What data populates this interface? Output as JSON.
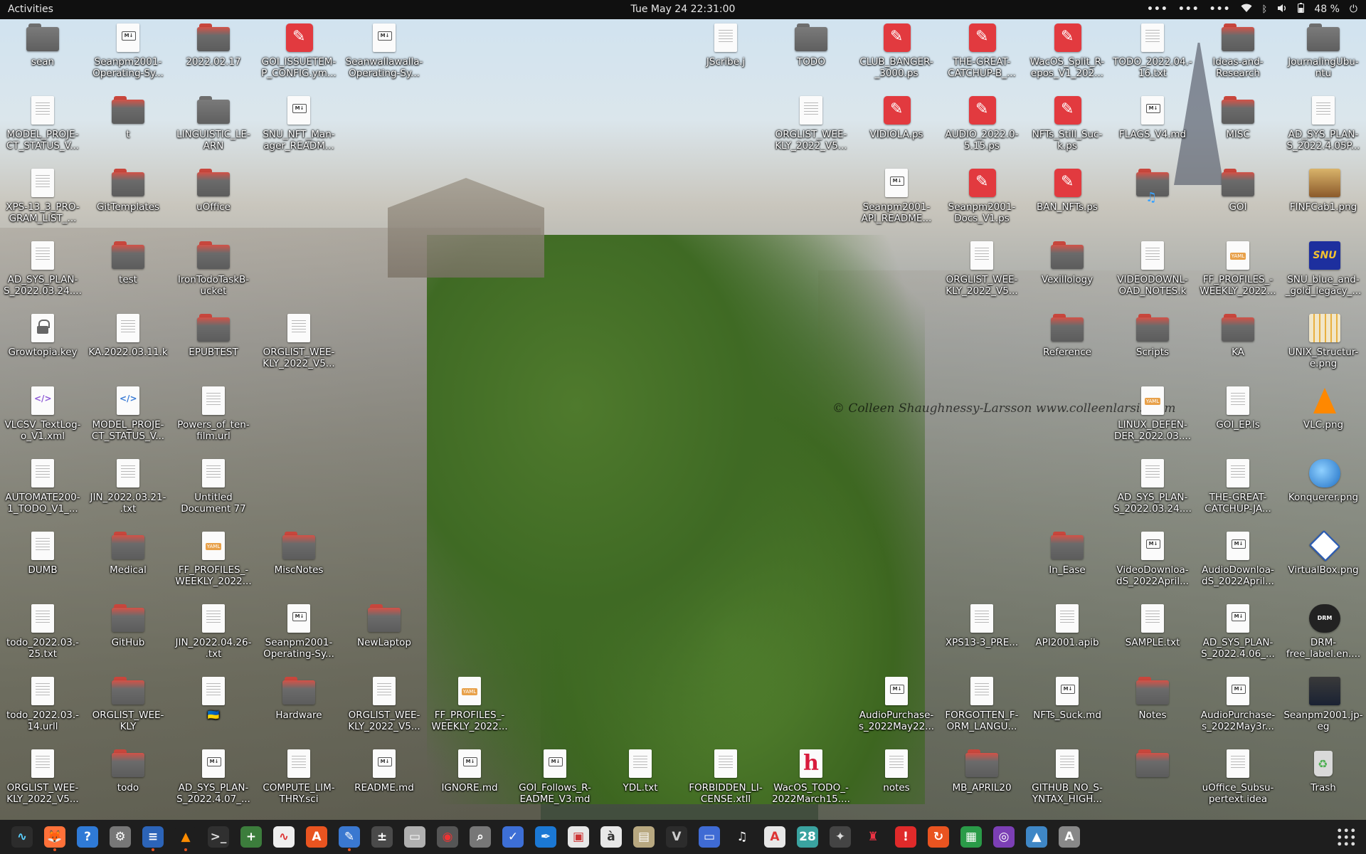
{
  "topbar": {
    "activities": "Activities",
    "clock": "Tue May 24  22:31:00",
    "overflow1": "•••",
    "overflow2": "•••",
    "overflow3": "•••",
    "battery": "48 %"
  },
  "wallpaper": {
    "watermark": "© Colleen Shaughnessy-Larsson www.colleenlarsis.com"
  },
  "desktop": {
    "icons": [
      {
        "label": "sean",
        "kind": "folder",
        "icon": "home-folder-icon"
      },
      {
        "label": "Seanpm2001-\nOperating-Sy...",
        "kind": "doc-md"
      },
      {
        "label": "2022.02.17",
        "kind": "folder-red"
      },
      {
        "label": "GOI_ISSUETEM-\nP_CONFIG.ym...",
        "kind": "ps"
      },
      {
        "label": "Seanwallawalla-\nOperating-Sy...",
        "kind": "doc-md"
      },
      {
        "label": "JScribe.j",
        "kind": "doc"
      },
      {
        "label": "TODO",
        "kind": "folder"
      },
      {
        "label": "CLUB_BANGER-\n_3000.ps",
        "kind": "ps"
      },
      {
        "label": "THE-GREAT-\nCATCHUP-B_...",
        "kind": "ps"
      },
      {
        "label": "WacOS_Split_R-\nepos_V1_202...",
        "kind": "ps"
      },
      {
        "label": "TODO_2022.04.-\n16.txt",
        "kind": "doc"
      },
      {
        "label": "Ideas-and-\nResearch",
        "kind": "folder-red"
      },
      {
        "label": "JournalingUbu-\nntu",
        "kind": "folder"
      },
      {
        "label": "MODEL_PROJE-\nCT_STATUS_V...",
        "kind": "doc"
      },
      {
        "label": "t",
        "kind": "folder-red"
      },
      {
        "label": "LINGUISTIC_LE-\nARN",
        "kind": "folder"
      },
      {
        "label": "SNU_NFT_Man-\nager_READM...",
        "kind": "doc-md"
      },
      {
        "label": "ORGLIST_WEE-\nKLY_2022_V5...",
        "kind": "doc"
      },
      {
        "label": "VIDIOLA.ps",
        "kind": "ps"
      },
      {
        "label": "AUDIO_2022.0-\n5.15.ps",
        "kind": "ps"
      },
      {
        "label": "NFTs_Still_Suc-\nk.ps",
        "kind": "ps"
      },
      {
        "label": "FLAGS_V4.md",
        "kind": "doc-md"
      },
      {
        "label": "MISC",
        "kind": "folder-red"
      },
      {
        "label": "AD_SYS_PLAN-\nS_2022.4.05P...",
        "kind": "doc"
      },
      {
        "label": "XPS-13_3_PRO-\nGRAM_LIST_...",
        "kind": "doc"
      },
      {
        "label": "GitTemplates",
        "kind": "folder-red"
      },
      {
        "label": "uOffice",
        "kind": "folder-red"
      },
      {
        "label": "Seanpm2001-\nAPI_README...",
        "kind": "doc-md"
      },
      {
        "label": "Seanpm2001-\nDocs_V1.ps",
        "kind": "ps"
      },
      {
        "label": "BAN_NFTs.ps",
        "kind": "ps"
      },
      {
        "label": "",
        "kind": "folder-music"
      },
      {
        "label": "GOI",
        "kind": "folder-red"
      },
      {
        "label": "FINFCab1.png",
        "kind": "img-cabinet"
      },
      {
        "label": "AD_SYS_PLAN-\nS_2022.03.24....",
        "kind": "doc"
      },
      {
        "label": "test",
        "kind": "folder-red"
      },
      {
        "label": "IronTodoTaskB-\nucket",
        "kind": "folder-red"
      },
      {
        "label": "ORGLIST_WEE-\nKLY_2022_V5...",
        "kind": "doc"
      },
      {
        "label": "Vexillology",
        "kind": "folder-red"
      },
      {
        "label": "VIDEODOWNL-\nOAD_NOTES.k",
        "kind": "doc"
      },
      {
        "label": "FF_PROFILES_-\nWEEKLY_2022...",
        "kind": "doc-yaml"
      },
      {
        "label": "SNU_blue_and-\n_gold_legacy_...",
        "kind": "img-snu"
      },
      {
        "label": "Growtopia.key",
        "kind": "doc-lock"
      },
      {
        "label": "KA.2022.03.11.k",
        "kind": "doc"
      },
      {
        "label": "EPUBTEST",
        "kind": "folder-red"
      },
      {
        "label": "ORGLIST_WEE-\nKLY_2022_V5...",
        "kind": "doc"
      },
      {
        "label": "Reference",
        "kind": "folder-red"
      },
      {
        "label": "Scripts",
        "kind": "folder-red"
      },
      {
        "label": "KA",
        "kind": "folder-red"
      },
      {
        "label": "UNIX_Structur-\ne.png",
        "kind": "img-unix"
      },
      {
        "label": "VLCSV_TextLog-\no_V1.xml",
        "kind": "doc-xml"
      },
      {
        "label": "MODEL_PROJE-\nCT_STATUS_V...",
        "kind": "doc-code"
      },
      {
        "label": "Powers_of_ten-\nfilm.url",
        "kind": "doc"
      },
      {
        "label": "LINUX_DEFEN-\nDER_2022.03....",
        "kind": "doc-yaml"
      },
      {
        "label": "GOI_EP.ls",
        "kind": "doc"
      },
      {
        "label": "VLC.png",
        "kind": "img-vlc"
      },
      {
        "label": "AUTOMATE200-\n1_TODO_V1_...",
        "kind": "doc"
      },
      {
        "label": "JIN_2022.03.21-\n.txt",
        "kind": "doc"
      },
      {
        "label": "Untitled\nDocument 77",
        "kind": "doc"
      },
      {
        "label": "AD_SYS_PLAN-\nS_2022.03.24....",
        "kind": "doc"
      },
      {
        "label": "THE-GREAT-\nCATCHUP-JA...",
        "kind": "doc"
      },
      {
        "label": "Konquerer.png",
        "kind": "img-konq"
      },
      {
        "label": "DUMB",
        "kind": "doc"
      },
      {
        "label": "Medical",
        "kind": "folder-red"
      },
      {
        "label": "FF_PROFILES_-\nWEEKLY_2022...",
        "kind": "doc-yaml"
      },
      {
        "label": "MiscNotes",
        "kind": "folder-red"
      },
      {
        "label": "In_Ease",
        "kind": "folder-red"
      },
      {
        "label": "VideoDownloa-\ndS_2022April...",
        "kind": "doc-md"
      },
      {
        "label": "AudioDownloa-\ndS_2022April...",
        "kind": "doc-md"
      },
      {
        "label": "VirtualBox.png",
        "kind": "img-vbox"
      },
      {
        "label": "todo_2022.03.-\n25.txt",
        "kind": "doc"
      },
      {
        "label": "GitHub",
        "kind": "folder-red"
      },
      {
        "label": "JIN_2022.04.26-\n.txt",
        "kind": "doc"
      },
      {
        "label": "Seanpm2001-\nOperating-Sy...",
        "kind": "doc-md"
      },
      {
        "label": "NewLaptop",
        "kind": "folder-red"
      },
      {
        "label": "XPS13-3_PRE...",
        "kind": "doc"
      },
      {
        "label": "API2001.apib",
        "kind": "doc"
      },
      {
        "label": "SAMPLE.txt",
        "kind": "doc"
      },
      {
        "label": "AD_SYS_PLAN-\nS_2022.4.06_...",
        "kind": "doc-md"
      },
      {
        "label": "DRM-\nfree_label.en....",
        "kind": "img-drm"
      },
      {
        "label": "todo_2022.03.-\n14.urll",
        "kind": "doc"
      },
      {
        "label": "ORGLIST_WEE-\nKLY",
        "kind": "folder-red"
      },
      {
        "label": "🇺🇦",
        "kind": "doc"
      },
      {
        "label": "Hardware",
        "kind": "folder-red"
      },
      {
        "label": "ORGLIST_WEE-\nKLY_2022_V5...",
        "kind": "doc"
      },
      {
        "label": "FF_PROFILES_-\nWEEKLY_2022...",
        "kind": "doc-yaml"
      },
      {
        "label": "AudioPurchase-\ns_2022May22...",
        "kind": "doc-md"
      },
      {
        "label": "FORGOTTEN_F-\nORM_LANGU...",
        "kind": "doc"
      },
      {
        "label": "NFTs_Suck.md",
        "kind": "doc-md"
      },
      {
        "label": "Notes",
        "kind": "folder-red"
      },
      {
        "label": "AudioPurchase-\ns_2022May3r...",
        "kind": "doc-md"
      },
      {
        "label": "Seanpm2001.jp-\neg",
        "kind": "img-photo"
      },
      {
        "label": "ORGLIST_WEE-\nKLY_2022_V5...",
        "kind": "doc"
      },
      {
        "label": "todo",
        "kind": "folder-red"
      },
      {
        "label": "AD_SYS_PLAN-\nS_2022.4.07_...",
        "kind": "doc-md"
      },
      {
        "label": "COMPUTE_LIM-\nTHRY.sci",
        "kind": "doc"
      },
      {
        "label": "README.md",
        "kind": "doc-md"
      },
      {
        "label": "IGNORE.md",
        "kind": "doc-md"
      },
      {
        "label": "GOI_Follows_R-\nEADME_V3.md",
        "kind": "doc-md"
      },
      {
        "label": "YDL.txt",
        "kind": "doc"
      },
      {
        "label": "FORBIDDEN_LI-\nCENSE.xtll",
        "kind": "doc"
      },
      {
        "label": "WacOS_TODO_-\n2022March15....",
        "kind": "doc-h"
      },
      {
        "label": "notes",
        "kind": "doc"
      },
      {
        "label": "MB_APRIL20",
        "kind": "folder-red"
      },
      {
        "label": "GITHUB_NO_S-\nYNTAX_HIGH...",
        "kind": "doc"
      },
      {
        "label": "",
        "kind": "folder-red"
      },
      {
        "label": "uOffice_Subsu-\npertext.idea",
        "kind": "doc"
      },
      {
        "label": "Trash",
        "kind": "trash"
      }
    ]
  },
  "dock": {
    "apps": [
      {
        "name": "system-monitor-icon",
        "bg": "#2c2c2c",
        "glyph": "∿",
        "color": "#5ad0ff"
      },
      {
        "name": "firefox-icon",
        "bg": "#ff7139",
        "glyph": "🦊",
        "color": "#fff"
      },
      {
        "name": "help-icon",
        "bg": "#2f7ad6",
        "glyph": "?",
        "color": "#fff"
      },
      {
        "name": "settings-icon",
        "bg": "#777",
        "glyph": "⚙",
        "color": "#fff"
      },
      {
        "name": "text-document-icon",
        "bg": "#2c64b8",
        "glyph": "≡",
        "color": "#fff"
      },
      {
        "name": "vlc-icon",
        "bg": "#1e1e1e",
        "glyph": "▲",
        "color": "#ff8c00"
      },
      {
        "name": "terminal-icon",
        "bg": "#303030",
        "glyph": ">_",
        "color": "#ddd"
      },
      {
        "name": "add-file-icon",
        "bg": "#3c7d3c",
        "glyph": "+",
        "color": "#fff"
      },
      {
        "name": "audio-editor-icon",
        "bg": "#eeeeee",
        "glyph": "∿",
        "color": "#d33"
      },
      {
        "name": "software-center-icon",
        "bg": "#e95420",
        "glyph": "A",
        "color": "#fff"
      },
      {
        "name": "text-editor-icon",
        "bg": "#3a78d0",
        "glyph": "✎",
        "color": "#fff"
      },
      {
        "name": "calculator-icon",
        "bg": "#4a4a4a",
        "glyph": "±",
        "color": "#fff"
      },
      {
        "name": "files-icon",
        "bg": "#b0b0b0",
        "glyph": "▭",
        "color": "#fff"
      },
      {
        "name": "disk-icon",
        "bg": "#555",
        "glyph": "◉",
        "color": "#e33"
      },
      {
        "name": "search-icon",
        "bg": "#777",
        "glyph": "⌕",
        "color": "#fff"
      },
      {
        "name": "tasks-icon",
        "bg": "#3d6fd6",
        "glyph": "✓",
        "color": "#fff"
      },
      {
        "name": "draw-icon",
        "bg": "#1b78d4",
        "glyph": "✒",
        "color": "#fff"
      },
      {
        "name": "screenshot-icon",
        "bg": "#e7e7e7",
        "glyph": "▣",
        "color": "#c33"
      },
      {
        "name": "character-map-icon",
        "bg": "#e8e8e8",
        "glyph": "à",
        "color": "#333"
      },
      {
        "name": "archive-icon",
        "bg": "#b8a880",
        "glyph": "▤",
        "color": "#fff"
      },
      {
        "name": "vim-icon",
        "bg": "#2c2c2c",
        "glyph": "V",
        "color": "#ccc"
      },
      {
        "name": "remote-desktop-icon",
        "bg": "#3f6bd4",
        "glyph": "▭",
        "color": "#fff"
      },
      {
        "name": "music-icon",
        "bg": "#1e1e1e",
        "glyph": "♫",
        "color": "#fff"
      },
      {
        "name": "pdf-icon",
        "bg": "#e7e7e7",
        "glyph": "A",
        "color": "#d33"
      },
      {
        "name": "calendar-icon",
        "bg": "#3aa3a0",
        "glyph": "28",
        "color": "#fff"
      },
      {
        "name": "gimp-icon",
        "bg": "#444",
        "glyph": "✦",
        "color": "#ddd"
      },
      {
        "name": "game-icon",
        "bg": "#1e1e1e",
        "glyph": "♜",
        "color": "#e34"
      },
      {
        "name": "alert-icon",
        "bg": "#e02a2a",
        "glyph": "!",
        "color": "#fff"
      },
      {
        "name": "update-icon",
        "bg": "#e95420",
        "glyph": "↻",
        "color": "#fff"
      },
      {
        "name": "spreadsheet-icon",
        "bg": "#2a9b48",
        "glyph": "▦",
        "color": "#fff"
      },
      {
        "name": "camera-icon",
        "bg": "#7c3fb5",
        "glyph": "◎",
        "color": "#fff"
      },
      {
        "name": "image-viewer-icon",
        "bg": "#3f87c6",
        "glyph": "▲",
        "color": "#fff"
      },
      {
        "name": "startup-disk-icon",
        "bg": "#888",
        "glyph": "A",
        "color": "#fff"
      }
    ],
    "running_indices": [
      1,
      4,
      5,
      10
    ]
  }
}
